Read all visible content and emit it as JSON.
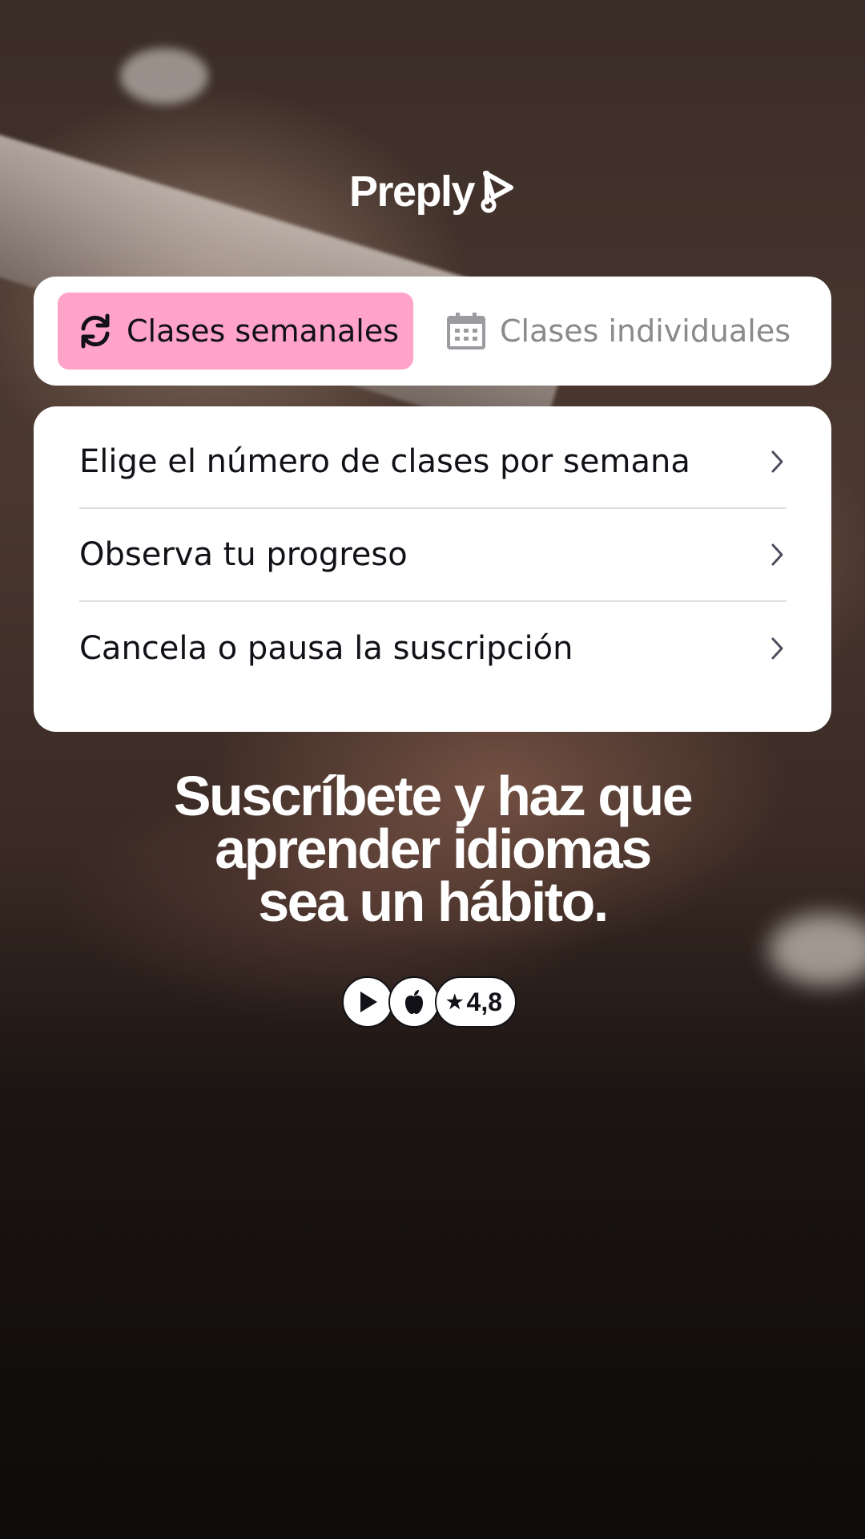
{
  "brand": {
    "name": "Preply"
  },
  "tabs": [
    {
      "label": "Clases semanales",
      "icon": "refresh-icon",
      "active": true
    },
    {
      "label": "Clases individuales",
      "icon": "calendar-icon",
      "active": false
    }
  ],
  "features": [
    {
      "label": "Elige el número de clases por semana",
      "icon": "chevron-right-icon"
    },
    {
      "label": "Observa tu progreso",
      "icon": "chevron-right-icon"
    },
    {
      "label": "Cancela o pausa la suscripción",
      "icon": "chevron-right-icon"
    }
  ],
  "headline": {
    "line1": "Suscríbete y haz que",
    "line2": "aprender idiomas",
    "line3": "sea un hábito."
  },
  "badges": {
    "google_play_icon": "play-store-icon",
    "apple_icon": "apple-icon",
    "rating": "4,8",
    "star_icon": "star-icon"
  },
  "colors": {
    "accent_pink": "#ffa3c8",
    "text_dark": "#121117",
    "text_muted": "#8a8a8e",
    "card_bg": "#ffffff"
  }
}
